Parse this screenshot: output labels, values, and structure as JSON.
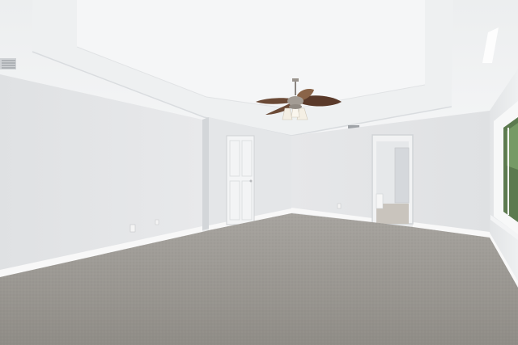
{
  "scene": {
    "subject": "empty-room",
    "colors": {
      "ceiling": "#f0f1f2",
      "wall": "#e4e6e8",
      "wall_shadow": "#d9dcdf",
      "trim": "#f7f7f7",
      "carpet": "#9a9791",
      "door": "#f2f3f4",
      "fan_blade": "#5a3a2a",
      "fan_light": "#f4efe4"
    },
    "icons": [
      "ceiling-fan-icon",
      "air-vent-icon",
      "outlet-icon"
    ]
  }
}
